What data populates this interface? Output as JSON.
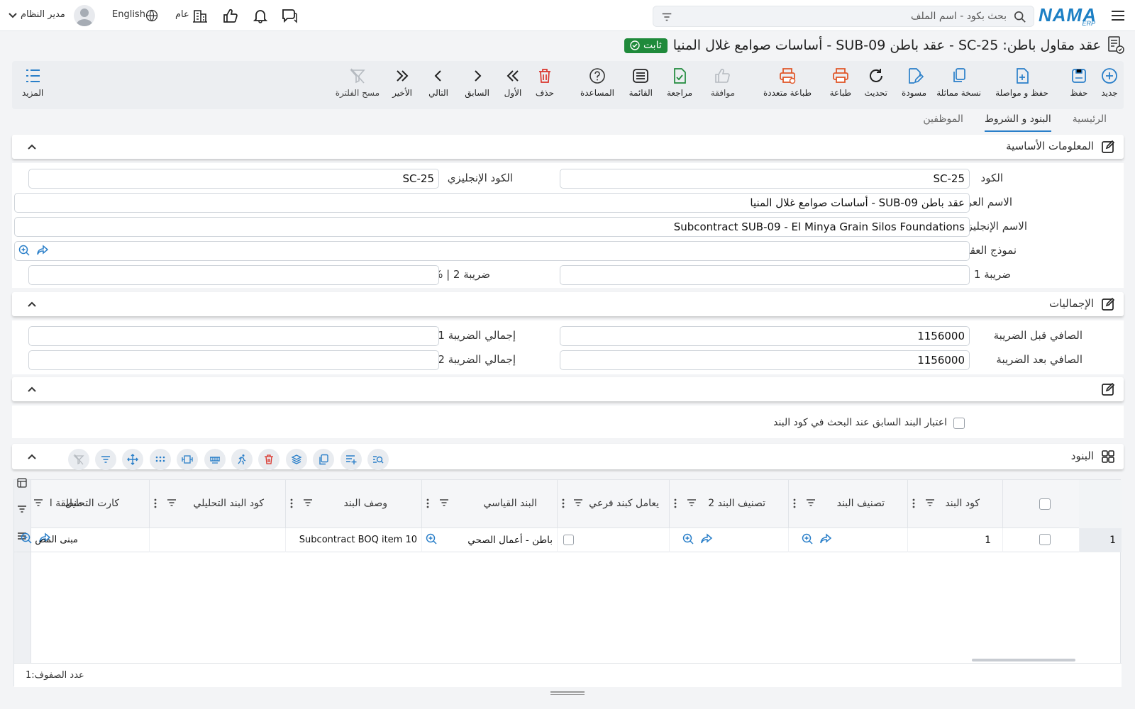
{
  "colors": {
    "accent": "#2a7fc9",
    "success": "#1f8a3b",
    "danger": "#d9342b",
    "print": "#e0572a"
  },
  "header": {
    "logo_text": "NAMA",
    "logo_sub": "ERP",
    "search_placeholder": "بحث بكود - اسم الملف",
    "language": "English",
    "branch": "عام",
    "user": "مدير النظام"
  },
  "title": {
    "text": "عقد مقاول باطن: SC-25 - عقد باطن SUB-09 - أساسات صوامع غلال المنيا",
    "status": "ثابت"
  },
  "toolbar": {
    "new": "جديد",
    "save": "حفظ",
    "save_continue": "حفظ و مواصلة",
    "copy": "نسخة مماثلة",
    "draft": "مسودة",
    "refresh": "تحديث",
    "print": "طباعة",
    "multi_print": "طباعة متعددة",
    "approve": "موافقة",
    "review": "مراجعة",
    "list": "القائمة",
    "help": "المساعدة",
    "delete": "حذف",
    "first": "الأول",
    "previous": "السابق",
    "next": "التالي",
    "last": "الأخير",
    "clear_filter": "مسح الفلترة",
    "more": "المزيد"
  },
  "tabs": [
    "الرئيسية",
    "البنود و الشروط",
    "الموظفين"
  ],
  "basic_info": {
    "title": "المعلومات الأساسية",
    "code_label": "الكود",
    "code_value": "SC-25",
    "en_code_label": "الكود الإنجليزي",
    "en_code_value": "SC-25",
    "ar_name_label": "الاسم العربي",
    "ar_name_value": "عقد باطن SUB-09 - أساسات صوامع غلال المنيا",
    "en_name_label": "الاسم الإنجليزي",
    "en_name_value": "Subcontract SUB-09 - El Minya Grain Silos Foundations",
    "template_label": "نموذج العقد",
    "tax1_label": "ضريبة 1 | %",
    "tax2_label": "ضريبة 2 | %"
  },
  "totals": {
    "title": "الإجماليات",
    "net_before_label": "الصافي قبل الضريبة",
    "net_before_value": "1156000",
    "net_after_label": "الصافي بعد الضريبة",
    "net_after_value": "1156000",
    "tax1_total_label": "إجمالي الضريبة 1",
    "tax2_total_label": "إجمالي الضريبة 2"
  },
  "options": {
    "prev_item_label": "اعتبار البند السابق عند البحث في كود البند"
  },
  "items": {
    "title": "البنود",
    "columns": [
      "كود البند",
      "تصنيف البند",
      "تصنيف البند 2",
      "يعامل كبند فرعي",
      "البند القياسي",
      "وصف البند",
      "كود البند التحليلي",
      "كارت التحليل",
      "منطقة ا"
    ],
    "rows": [
      {
        "num": "1",
        "code": "1",
        "standard_item": "باطن - أعمال الصحي",
        "description": "Subcontract BOQ item 10",
        "zone": "مبنى المص"
      }
    ],
    "row_count_label": "عدد الصفوف:",
    "row_count": "1"
  }
}
